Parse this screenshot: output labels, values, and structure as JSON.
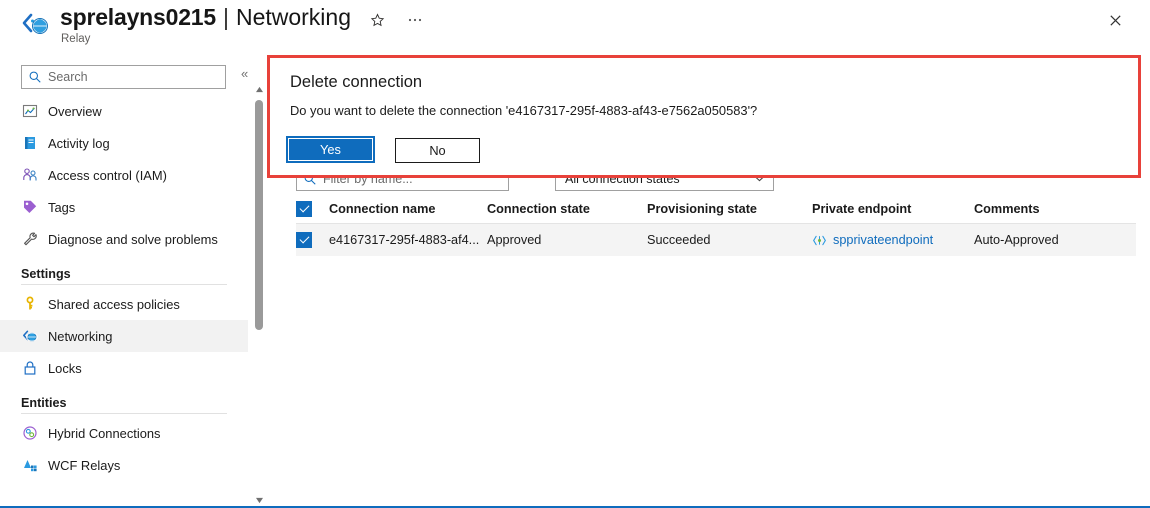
{
  "header": {
    "resource_icon": "relay-networking-icon",
    "title": "sprelayns0215",
    "separator": "|",
    "page": "Networking",
    "caption": "Relay",
    "star_icon": "star-icon",
    "ellipsis_icon": "ellipsis-icon",
    "close_icon": "close-icon"
  },
  "sidebar": {
    "search": {
      "placeholder": "Search",
      "icon": "search-icon"
    },
    "collapse_icon": "«",
    "items": [
      {
        "label": "Overview",
        "icon": "overview-icon",
        "selected": false
      },
      {
        "label": "Activity log",
        "icon": "activity-log-icon",
        "selected": false
      },
      {
        "label": "Access control (IAM)",
        "icon": "access-control-icon",
        "selected": false
      },
      {
        "label": "Tags",
        "icon": "tags-icon",
        "selected": false
      },
      {
        "label": "Diagnose and solve problems",
        "icon": "diagnose-icon",
        "selected": false
      }
    ],
    "groups": [
      {
        "title": "Settings",
        "items": [
          {
            "label": "Shared access policies",
            "icon": "key-icon",
            "selected": false
          },
          {
            "label": "Networking",
            "icon": "networking-icon",
            "selected": true
          },
          {
            "label": "Locks",
            "icon": "lock-icon",
            "selected": false
          }
        ]
      },
      {
        "title": "Entities",
        "items": [
          {
            "label": "Hybrid Connections",
            "icon": "hybrid-connections-icon",
            "selected": false
          },
          {
            "label": "WCF Relays",
            "icon": "wcf-relays-icon",
            "selected": false
          }
        ]
      }
    ]
  },
  "main": {
    "filters": {
      "name_placeholder": "Filter by name...",
      "name_icon": "filter-icon",
      "state_value": "All connection states",
      "state_chevron": "chevron-down-icon"
    },
    "table": {
      "columns": [
        "Connection name",
        "Connection state",
        "Provisioning state",
        "Private endpoint",
        "Comments"
      ],
      "header_checkbox_checked": true,
      "rows": [
        {
          "checked": true,
          "connection_name": "e4167317-295f-4883-af4...",
          "connection_state": "Approved",
          "provisioning_state": "Succeeded",
          "private_endpoint": "spprivateendpoint",
          "private_endpoint_icon": "private-endpoint-icon",
          "comments": "Auto-Approved"
        }
      ]
    }
  },
  "dialog": {
    "title": "Delete connection",
    "message": "Do you want to delete the connection 'e4167317-295f-4883-af43-e7562a050583'?",
    "yes_label": "Yes",
    "no_label": "No",
    "border_color": "#e8413a"
  },
  "colors": {
    "accent": "#0f6cbd",
    "alert_border": "#e8413a",
    "selected_row": "#f4f4f4",
    "selected_nav": "#f2f2f2"
  }
}
